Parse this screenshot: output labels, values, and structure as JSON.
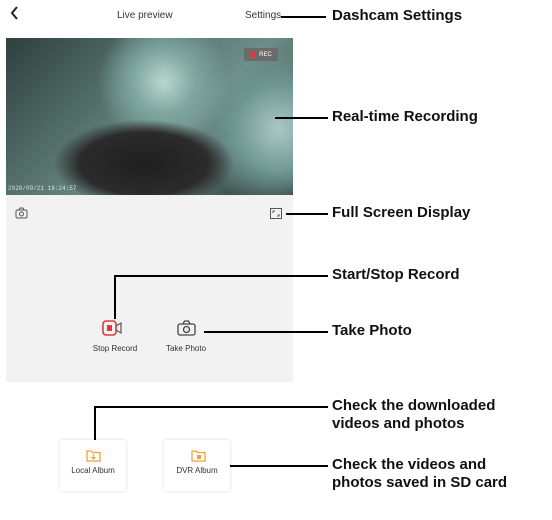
{
  "header": {
    "back_icon": "chevron-left-icon",
    "title": "Live preview",
    "settings_label": "Settings"
  },
  "preview": {
    "rec_label": "REC",
    "timestamp": "2020/09/21 18:24:57"
  },
  "controls": {
    "snapshot_icon": "camera-icon",
    "fullscreen_icon": "fullscreen-icon",
    "stop_record_label": "Stop Record",
    "take_photo_label": "Take Photo"
  },
  "albums": {
    "local": {
      "label": "Local Album",
      "icon": "folder-download-icon"
    },
    "dvr": {
      "label": "DVR Album",
      "icon": "folder-sd-icon"
    }
  },
  "callouts": {
    "settings": "Dashcam Settings",
    "recording": "Real-time Recording",
    "fullscreen": "Full Screen Display",
    "start_stop": "Start/Stop Record",
    "take_photo": "Take Photo",
    "downloaded_line1": "Check the downloaded",
    "downloaded_line2": "videos and photos",
    "sd_line1": "Check the videos and",
    "sd_line2": "photos saved in SD card"
  },
  "colors": {
    "record_red": "#e23a3a",
    "album_orange": "#f0a030",
    "panel_gray": "#f2f2f2"
  }
}
